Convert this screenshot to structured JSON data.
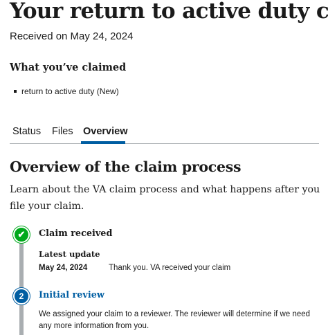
{
  "page": {
    "title": "Your return to active duty claim",
    "received": "Received on May 24, 2024"
  },
  "claimed": {
    "heading": "What you’ve claimed",
    "items": [
      "return to active duty (New)"
    ]
  },
  "tabs": [
    {
      "label": "Status",
      "active": false
    },
    {
      "label": "Files",
      "active": false
    },
    {
      "label": "Overview",
      "active": true
    }
  ],
  "overview": {
    "title": "Overview of the claim process",
    "intro": "Learn about the VA claim process and what happens after you file your claim."
  },
  "timeline": {
    "steps": [
      {
        "marker": "✔",
        "status": "complete",
        "title": "Claim received",
        "latest_update_label": "Latest update",
        "date": "May 24, 2024",
        "update_text": "Thank you. VA received your claim"
      },
      {
        "marker": "2",
        "status": "current",
        "title": "Initial review",
        "description": "We assigned your claim to a reviewer. The reviewer will determine if we need any more information from you."
      }
    ]
  },
  "colors": {
    "text": "#1b1b1b",
    "primary": "#005ea2",
    "success": "#00a91c",
    "rail": "#a9aeb1",
    "tab_border": "#a9aeb1"
  }
}
